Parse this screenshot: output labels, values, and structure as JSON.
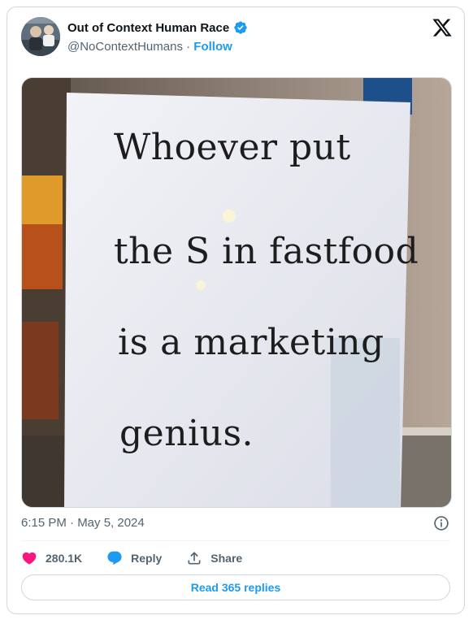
{
  "tweet": {
    "author_name": "Out of Context Human Race",
    "handle": "@NoContextHumans",
    "separator": " · ",
    "follow_label": "Follow",
    "timestamp": "6:15 PM · May 5, 2024",
    "image_text": {
      "line1": "Whoever put",
      "line2": "the S in fastfood",
      "line3": "is a marketing",
      "line4": "genius."
    }
  },
  "actions": {
    "likes": "280.1K",
    "reply_label": "Reply",
    "share_label": "Share",
    "read_replies": "Read 365 replies"
  },
  "colors": {
    "accent": "#1d9bf0",
    "like": "#f91880",
    "text_secondary": "#536471"
  },
  "icons": {
    "verified": "verified-badge-icon",
    "x_logo": "x-logo-icon",
    "info": "info-icon",
    "like": "heart-icon",
    "reply": "reply-bubble-icon",
    "share": "share-icon"
  }
}
